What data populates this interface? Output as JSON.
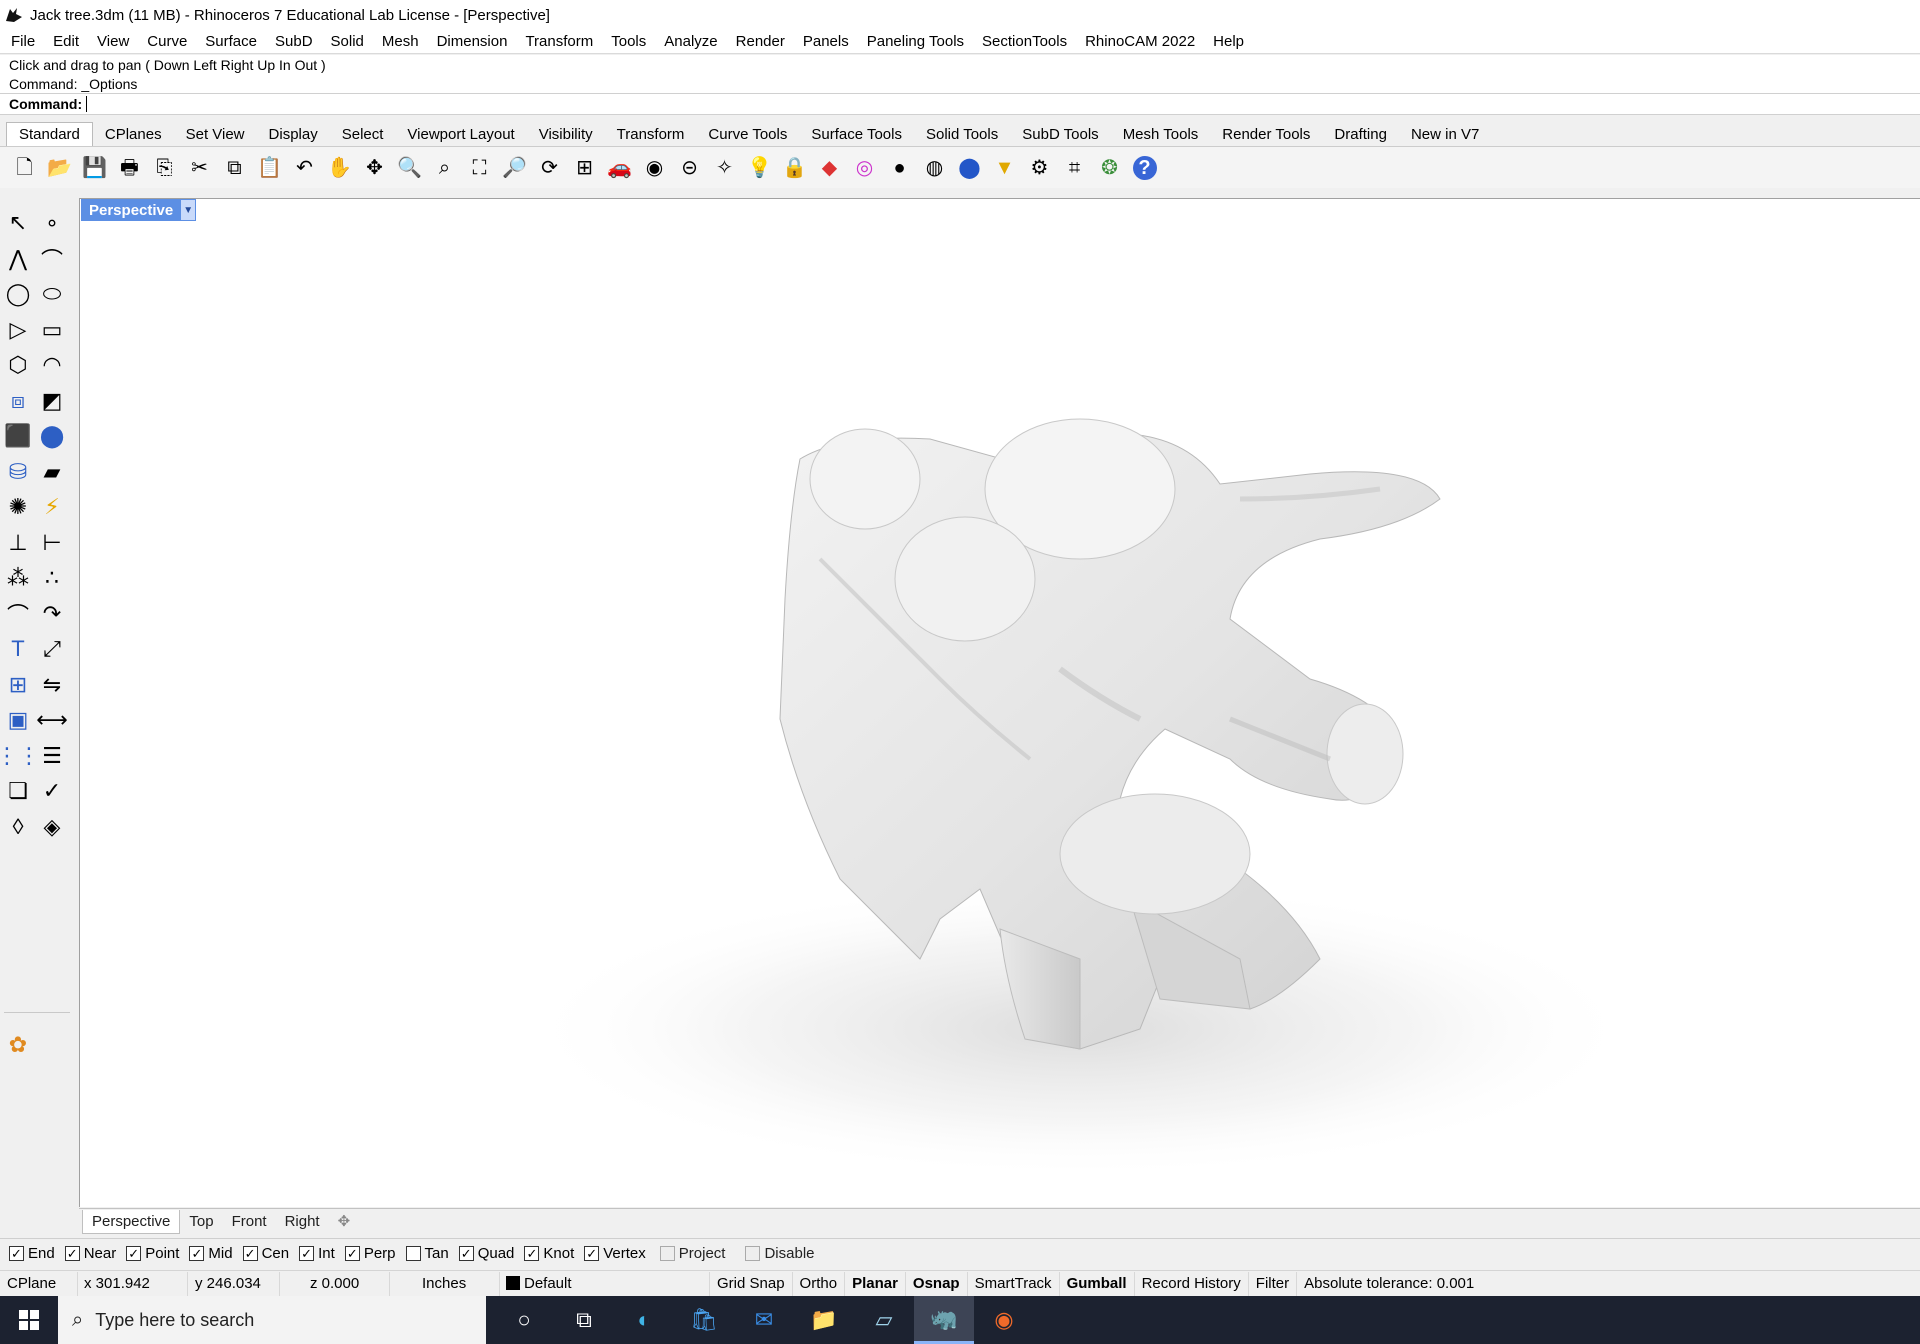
{
  "window": {
    "title": "Jack tree.3dm (11 MB) - Rhinoceros 7 Educational Lab License - [Perspective]"
  },
  "menu": [
    "File",
    "Edit",
    "View",
    "Curve",
    "Surface",
    "SubD",
    "Solid",
    "Mesh",
    "Dimension",
    "Transform",
    "Tools",
    "Analyze",
    "Render",
    "Panels",
    "Paneling Tools",
    "SectionTools",
    "RhinoCAM 2022",
    "Help"
  ],
  "command": {
    "history_1": "Click and drag to pan ( Down  Left  Right  Up  In  Out )",
    "history_2": "Command: _Options",
    "prompt_label": "Command:",
    "input_value": ""
  },
  "toolbar_tabs": [
    "Standard",
    "CPlanes",
    "Set View",
    "Display",
    "Select",
    "Viewport Layout",
    "Visibility",
    "Transform",
    "Curve Tools",
    "Surface Tools",
    "Solid Tools",
    "SubD Tools",
    "Mesh Tools",
    "Render Tools",
    "Drafting",
    "New in V7"
  ],
  "toolbar_icons": [
    "new-document-icon",
    "open-folder-icon",
    "save-icon",
    "print-icon",
    "import-icon",
    "cut-icon",
    "copy-icon",
    "paste-icon",
    "undo-icon",
    "pan-hand-icon",
    "move-view-icon",
    "zoom-icon",
    "zoom-window-icon",
    "zoom-extents-icon",
    "zoom-selected-icon",
    "rotate-view-icon",
    "four-viewports-icon",
    "car-icon",
    "display-mode-icon",
    "cplane-icon",
    "show-objects-icon",
    "light-bulb-icon",
    "lock-icon",
    "layer-icon",
    "color-wheel-icon",
    "shaded-sphere-icon",
    "rendered-sphere-icon",
    "render-sphere-icon",
    "select-filter-icon",
    "settings-gear-icon",
    "snap-icon",
    "grasshopper-icon",
    "help-icon"
  ],
  "left_tools": [
    "select-arrow-icon",
    "point-icon",
    "polyline-icon",
    "curve-icon",
    "circle-icon",
    "ellipse-icon",
    "triangle-icon",
    "rectangle-icon",
    "polygon-icon",
    "arc-icon",
    "surface-icon",
    "surface-edit-icon",
    "box-icon",
    "solid-union-icon",
    "cylinder-icon",
    "plane-icon",
    "mesh-tools-icon",
    "lightning-icon",
    "extend-icon",
    "trim-icon",
    "group-icon",
    "ungroup-icon",
    "fillet-icon",
    "blend-icon",
    "text-icon",
    "scale-icon",
    "array-icon",
    "mirror-icon",
    "block-icon",
    "dimension-icon",
    "grid-array-icon",
    "properties-icon",
    "layers-icon",
    "check-icon",
    "analyze-icon",
    "render-icon",
    "maple-leaf-icon"
  ],
  "viewport": {
    "label": "Perspective",
    "tabs": [
      "Perspective",
      "Top",
      "Front",
      "Right"
    ]
  },
  "osnaps": [
    {
      "label": "End",
      "checked": true
    },
    {
      "label": "Near",
      "checked": true
    },
    {
      "label": "Point",
      "checked": true
    },
    {
      "label": "Mid",
      "checked": true
    },
    {
      "label": "Cen",
      "checked": true
    },
    {
      "label": "Int",
      "checked": true
    },
    {
      "label": "Perp",
      "checked": true
    },
    {
      "label": "Tan",
      "checked": false
    },
    {
      "label": "Quad",
      "checked": true
    },
    {
      "label": "Knot",
      "checked": true
    },
    {
      "label": "Vertex",
      "checked": true
    },
    {
      "label": "Project",
      "checked": false,
      "disabled": true
    },
    {
      "label": "Disable",
      "checked": false,
      "disabled": true
    }
  ],
  "status": {
    "cplane": "CPlane",
    "x": "x 301.942",
    "y": "y 246.034",
    "z": "z 0.000",
    "units": "Inches",
    "layer": "Default",
    "grid_snap": "Grid Snap",
    "ortho": "Ortho",
    "planar": "Planar",
    "osnap": "Osnap",
    "smarttrack": "SmartTrack",
    "gumball": "Gumball",
    "record_history": "Record History",
    "filter": "Filter",
    "tolerance": "Absolute tolerance: 0.001"
  },
  "taskbar": {
    "search_placeholder": "Type here to search",
    "apps": [
      "cortana-icon",
      "task-view-icon",
      "edge-icon",
      "store-icon",
      "mail-icon",
      "file-explorer-icon",
      "app-icon",
      "rhino-icon",
      "app-orange-icon"
    ]
  },
  "colors": {
    "viewport_label_bg": "#5c8fe4",
    "taskbar_bg": "#1c2230"
  }
}
